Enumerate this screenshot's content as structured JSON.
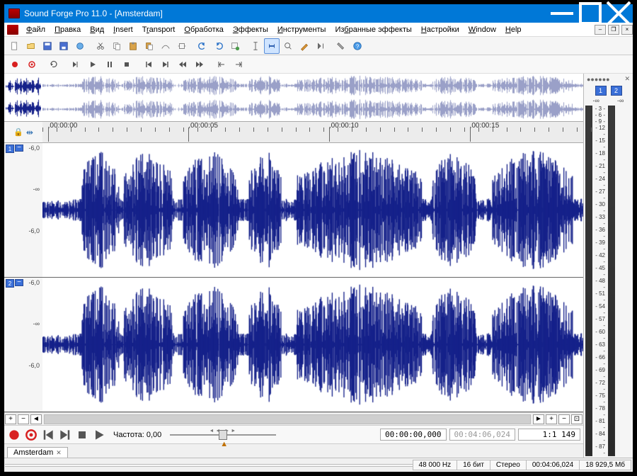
{
  "window": {
    "title": "Sound Forge Pro 11.0 - [Amsterdam]"
  },
  "menus": {
    "file": "Файл",
    "edit": "Правка",
    "view": "Вид",
    "insert": "Insert",
    "transport": "Transport",
    "process": "Обработка",
    "effects": "Эффекты",
    "tools": "Инструменты",
    "favorites": "Избранные эффекты",
    "settings": "Настройки",
    "window": "Window",
    "help": "Help"
  },
  "overview_thumb": {
    "channels": 2
  },
  "ruler": {
    "labels": [
      {
        "pos": 1,
        "text": ",00:00:00"
      },
      {
        "pos": 27,
        "text": ",00:00:05"
      },
      {
        "pos": 53,
        "text": ",00:00:10"
      },
      {
        "pos": 79,
        "text": ",00:00:15"
      }
    ]
  },
  "channels": [
    {
      "num": "1",
      "scale_top": "-6,0",
      "scale_mid": "-∞",
      "scale_bot": "-6,0"
    },
    {
      "num": "2",
      "scale_top": "-6,0",
      "scale_mid": "-∞",
      "scale_bot": "-6,0"
    }
  ],
  "bottom": {
    "rate_label": "Частота: 0,00",
    "time_current": "00:00:00,000",
    "time_total": "00:04:06,024",
    "zoom_ratio": "1:1 149"
  },
  "tab": {
    "name": "Amsterdam"
  },
  "meters": {
    "title": "●●●●●●",
    "ch1": "1",
    "ch2": "2",
    "inf1": "-∞",
    "inf2": "-∞",
    "scale": [
      "- 3 -",
      "- 6 -",
      "- 9 -",
      "- 12 -",
      "- 15 -",
      "- 18 -",
      "- 21 -",
      "- 24 -",
      "- 27 -",
      "- 30 -",
      "- 33 -",
      "- 36 -",
      "- 39 -",
      "- 42 -",
      "- 45 -",
      "- 48 -",
      "- 51 -",
      "- 54 -",
      "- 57 -",
      "- 60 -",
      "- 63 -",
      "- 66 -",
      "- 69 -",
      "- 72 -",
      "- 75 -",
      "- 78 -",
      "- 81 -",
      "- 84 -",
      "- 87 -"
    ]
  },
  "status": {
    "sample_rate": "48 000 Hz",
    "bit_depth": "16 бит",
    "channels": "Стерео",
    "duration": "00:04:06,024",
    "disk": "18 929,5 Мб"
  }
}
